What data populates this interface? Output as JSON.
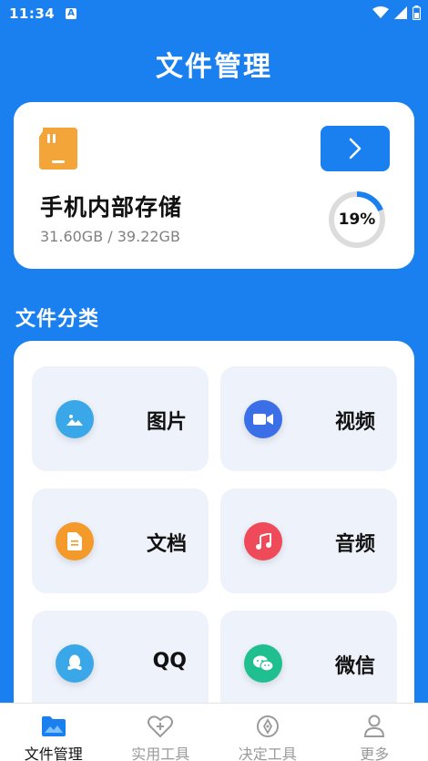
{
  "status": {
    "time": "11:34",
    "a_icon_label": "A"
  },
  "page": {
    "title": "文件管理"
  },
  "storage": {
    "title": "手机内部存储",
    "size_text": "31.60GB / 39.22GB",
    "percent_text": "19%",
    "percent": 0.19
  },
  "categories": {
    "title": "文件分类",
    "items": [
      {
        "label": "图片",
        "icon": "image-icon",
        "color": "#3aa8e8"
      },
      {
        "label": "视频",
        "icon": "video-camera-icon",
        "color": "#3b6fe8"
      },
      {
        "label": "文档",
        "icon": "document-icon",
        "color": "#f39a2b"
      },
      {
        "label": "音频",
        "icon": "music-note-icon",
        "color": "#ef4a5a"
      },
      {
        "label": "QQ",
        "icon": "qq-icon",
        "color": "#3aa8e8"
      },
      {
        "label": "微信",
        "icon": "wechat-icon",
        "color": "#1fbf8f"
      }
    ]
  },
  "nav": {
    "items": [
      {
        "label": "文件管理",
        "icon": "folder-icon",
        "active": true
      },
      {
        "label": "实用工具",
        "icon": "heart-plus-icon",
        "active": false
      },
      {
        "label": "决定工具",
        "icon": "compass-icon",
        "active": false
      },
      {
        "label": "更多",
        "icon": "person-icon",
        "active": false
      }
    ]
  },
  "colors": {
    "primary": "#1a80f0",
    "tile_bg": "#eef2fb",
    "sd_card": "#f3a53a"
  }
}
